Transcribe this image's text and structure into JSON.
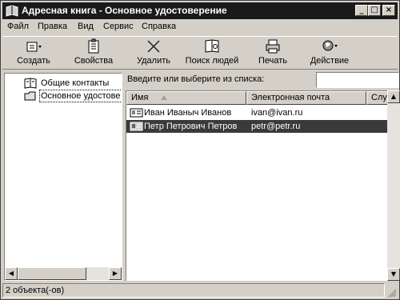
{
  "window": {
    "title": "Адресная книга - Основное удостоверение"
  },
  "title_buttons": {
    "minimize": "_",
    "maximize": "□",
    "close": "×"
  },
  "menu": [
    {
      "label": "Файл"
    },
    {
      "label": "Правка"
    },
    {
      "label": "Вид"
    },
    {
      "label": "Сервис"
    },
    {
      "label": "Справка"
    }
  ],
  "toolbar": [
    {
      "label": "Создать",
      "icon": "new-contact-icon"
    },
    {
      "label": "Свойства",
      "icon": "properties-icon"
    },
    {
      "label": "Удалить",
      "icon": "delete-icon"
    },
    {
      "label": "Поиск людей",
      "icon": "find-people-icon"
    },
    {
      "label": "Печать",
      "icon": "print-icon"
    },
    {
      "label": "Действие",
      "icon": "action-icon"
    }
  ],
  "tree": [
    {
      "label": "Общие контакты",
      "icon": "shared-contacts-icon"
    },
    {
      "label": "Основное удостове",
      "icon": "folder-icon",
      "selected": true
    }
  ],
  "search": {
    "label": "Введите или выберите из списка:",
    "value": ""
  },
  "list": {
    "columns": [
      "Имя",
      "Электронная почта",
      "Служе"
    ],
    "rows": [
      {
        "name": "Иван Иваныч Иванов",
        "email": "ivan@ivan.ru",
        "selected": false
      },
      {
        "name": "Петр Петрович Петров",
        "email": "petr@petr.ru",
        "selected": true
      }
    ]
  },
  "status": {
    "text": "2 объекта(-ов)"
  },
  "colors": {
    "titlebar": "#1a1a1a",
    "face": "#d4d0c8",
    "selection": "#3a3a3a"
  }
}
